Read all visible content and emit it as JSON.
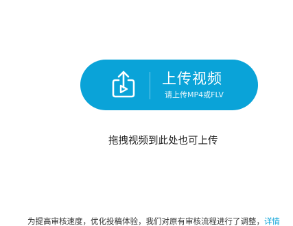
{
  "upload": {
    "button_title": "上传视频",
    "button_subtitle": "请上传MP4或FLV",
    "drag_hint": "拖拽视频到此处也可上传",
    "icon": "upload-video-icon"
  },
  "notice": {
    "text": "为提高审核速度，优化投稿体验，我们对原有审核流程进行了调整，",
    "link_label": "详情"
  },
  "colors": {
    "accent": "#0aa3d8",
    "background": "#ffffff",
    "text": "#222222"
  }
}
